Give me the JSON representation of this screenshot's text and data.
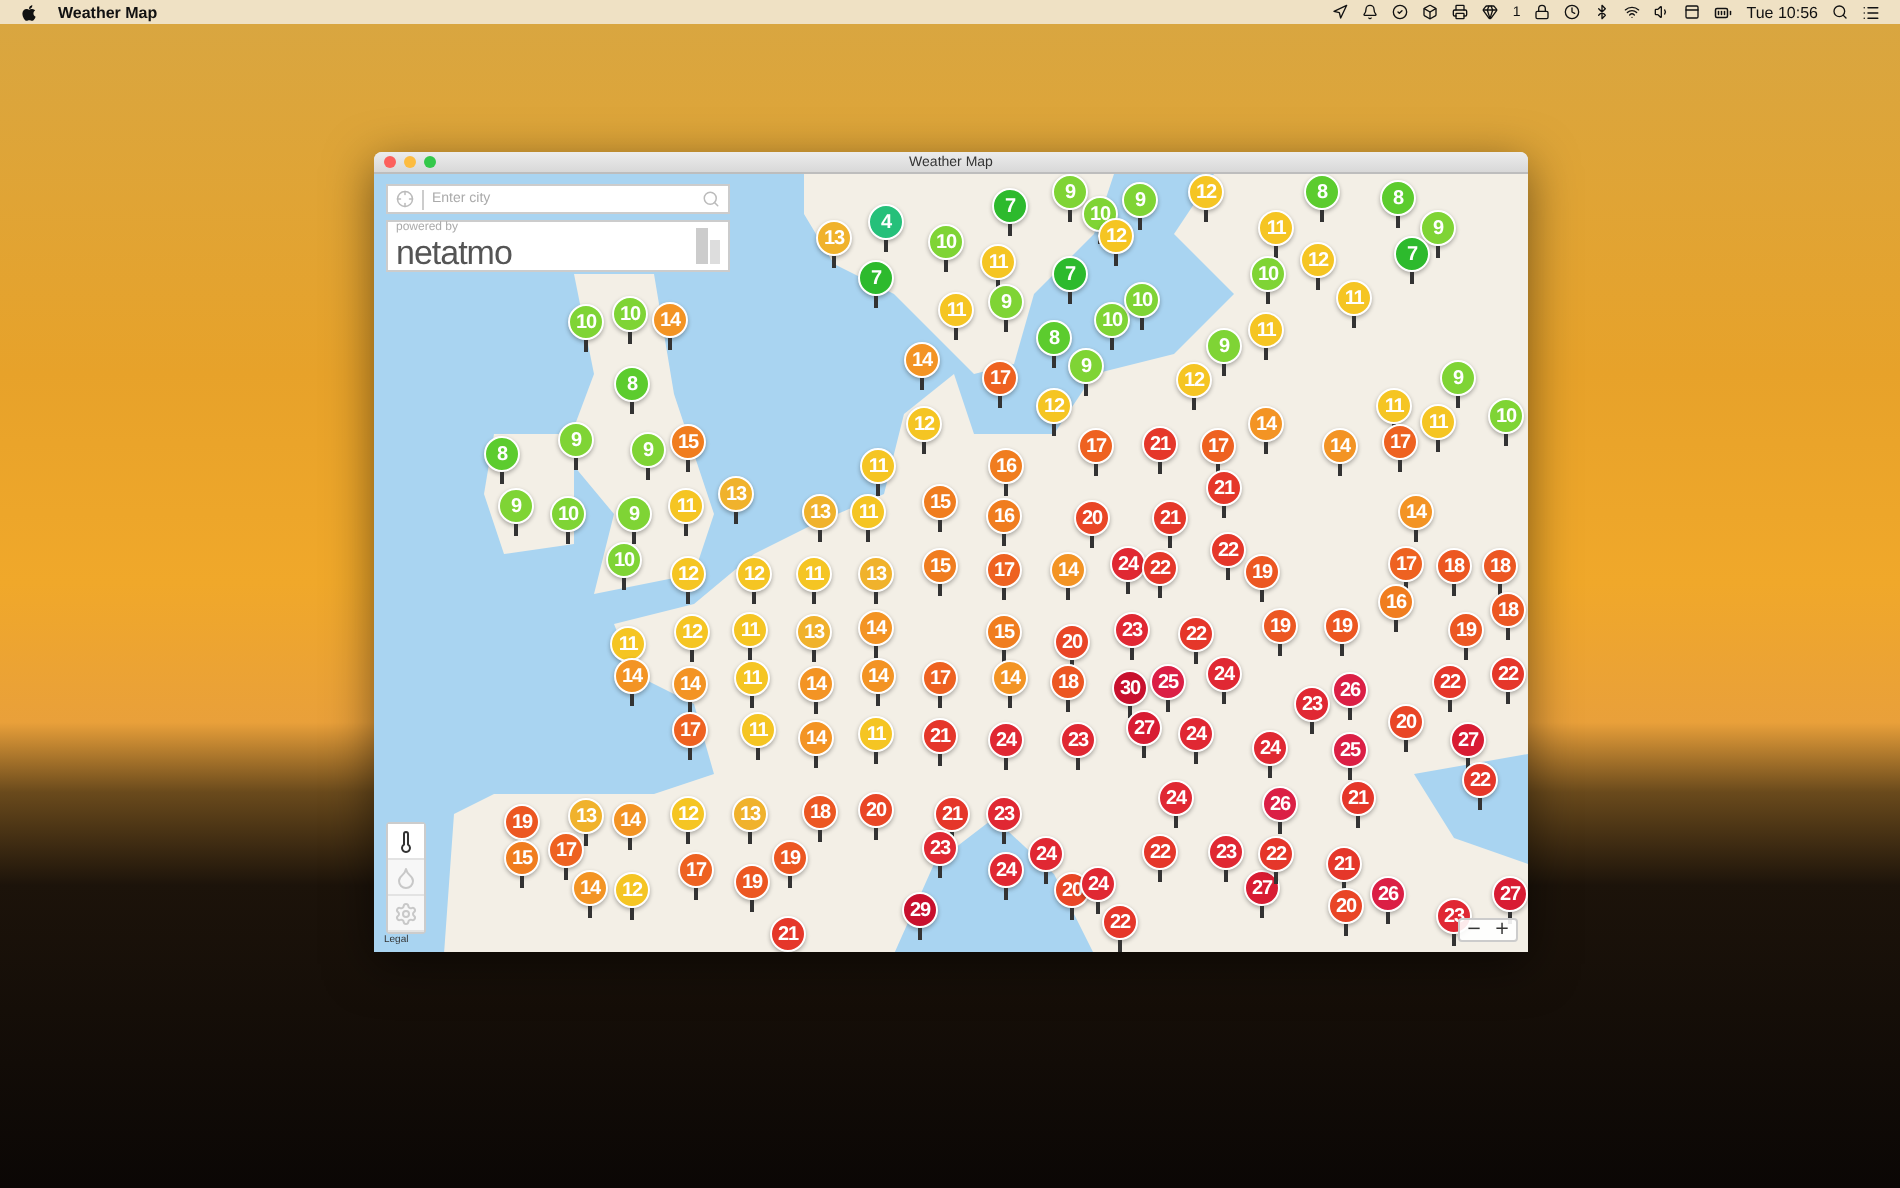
{
  "menu_bar": {
    "app_name": "Weather Map",
    "status_badge": "1",
    "clock": "Tue 10:56"
  },
  "window": {
    "title": "Weather Map"
  },
  "search": {
    "placeholder": "Enter city"
  },
  "sponsor": {
    "caption": "powered by",
    "logo": "netatmo"
  },
  "tools": [
    {
      "kind": "temperature",
      "selected": true
    },
    {
      "kind": "humidity",
      "selected": false
    },
    {
      "kind": "settings",
      "selected": false
    }
  ],
  "legal": "Legal",
  "zoom": {
    "out": "−",
    "in": "+"
  },
  "pins": [
    {
      "temp": "4",
      "color": "#25c07a"
    },
    {
      "temp": "7",
      "color": "#2dba2d"
    },
    {
      "temp": "9",
      "color": "#7fd435"
    },
    {
      "temp": "12",
      "color": "#f5c523"
    },
    {
      "temp": "8",
      "color": "#5ccc2e"
    },
    {
      "temp": "13",
      "color": "#f0b22c"
    },
    {
      "temp": "10",
      "color": "#7fd435"
    },
    {
      "temp": "7",
      "color": "#2dba2d"
    },
    {
      "temp": "11",
      "color": "#f5c523"
    },
    {
      "temp": "7",
      "color": "#2dba2d"
    },
    {
      "temp": "10",
      "color": "#7fd435"
    },
    {
      "temp": "9",
      "color": "#7fd435"
    },
    {
      "temp": "12",
      "color": "#f5c523"
    },
    {
      "temp": "8",
      "color": "#5ccc2e"
    },
    {
      "temp": "9",
      "color": "#7fd435"
    },
    {
      "temp": "7",
      "color": "#2dba2d"
    },
    {
      "temp": "11",
      "color": "#f5c523"
    },
    {
      "temp": "10",
      "color": "#7fd435"
    },
    {
      "temp": "12",
      "color": "#f5c523"
    },
    {
      "temp": "11",
      "color": "#f5c523"
    },
    {
      "temp": "10",
      "color": "#7fd435"
    },
    {
      "temp": "10",
      "color": "#7fd435"
    },
    {
      "temp": "14",
      "color": "#f39424"
    },
    {
      "temp": "11",
      "color": "#f5c523"
    },
    {
      "temp": "9",
      "color": "#7fd435"
    },
    {
      "temp": "10",
      "color": "#7fd435"
    },
    {
      "temp": "10",
      "color": "#7fd435"
    },
    {
      "temp": "8",
      "color": "#5ccc2e"
    },
    {
      "temp": "9",
      "color": "#7fd435"
    },
    {
      "temp": "9",
      "color": "#7fd435"
    },
    {
      "temp": "11",
      "color": "#f5c523"
    },
    {
      "temp": "12",
      "color": "#f5c523"
    },
    {
      "temp": "12",
      "color": "#f5c523"
    },
    {
      "temp": "11",
      "color": "#f5c523"
    },
    {
      "temp": "11",
      "color": "#f5c523"
    },
    {
      "temp": "9",
      "color": "#7fd435"
    },
    {
      "temp": "10",
      "color": "#7fd435"
    },
    {
      "temp": "14",
      "color": "#f39424"
    },
    {
      "temp": "17",
      "color": "#ee6221"
    },
    {
      "temp": "12",
      "color": "#f5c523"
    },
    {
      "temp": "8",
      "color": "#5ccc2e"
    },
    {
      "temp": "8",
      "color": "#5ccc2e"
    },
    {
      "temp": "9",
      "color": "#7fd435"
    },
    {
      "temp": "9",
      "color": "#7fd435"
    },
    {
      "temp": "15",
      "color": "#f07d1f"
    },
    {
      "temp": "9",
      "color": "#7fd435"
    },
    {
      "temp": "10",
      "color": "#7fd435"
    },
    {
      "temp": "9",
      "color": "#7fd435"
    },
    {
      "temp": "11",
      "color": "#f5c523"
    },
    {
      "temp": "13",
      "color": "#f0b22c"
    },
    {
      "temp": "13",
      "color": "#f0b22c"
    },
    {
      "temp": "11",
      "color": "#f5c523"
    },
    {
      "temp": "11",
      "color": "#f5c523"
    },
    {
      "temp": "15",
      "color": "#f07d1f"
    },
    {
      "temp": "16",
      "color": "#f07d1f"
    },
    {
      "temp": "16",
      "color": "#f07d1f"
    },
    {
      "temp": "17",
      "color": "#ee6221"
    },
    {
      "temp": "21",
      "color": "#e5372a"
    },
    {
      "temp": "17",
      "color": "#ee6221"
    },
    {
      "temp": "14",
      "color": "#f39424"
    },
    {
      "temp": "14",
      "color": "#f39424"
    },
    {
      "temp": "17",
      "color": "#ee6221"
    },
    {
      "temp": "21",
      "color": "#e5372a"
    },
    {
      "temp": "20",
      "color": "#e94626"
    },
    {
      "temp": "21",
      "color": "#e5372a"
    },
    {
      "temp": "14",
      "color": "#f39424"
    },
    {
      "temp": "10",
      "color": "#7fd435"
    },
    {
      "temp": "12",
      "color": "#f5c523"
    },
    {
      "temp": "12",
      "color": "#f5c523"
    },
    {
      "temp": "11",
      "color": "#f5c523"
    },
    {
      "temp": "13",
      "color": "#f0b22c"
    },
    {
      "temp": "15",
      "color": "#f07d1f"
    },
    {
      "temp": "17",
      "color": "#ee6221"
    },
    {
      "temp": "14",
      "color": "#f39424"
    },
    {
      "temp": "24",
      "color": "#e02833"
    },
    {
      "temp": "22",
      "color": "#e5372a"
    },
    {
      "temp": "22",
      "color": "#e5372a"
    },
    {
      "temp": "19",
      "color": "#ec5722"
    },
    {
      "temp": "17",
      "color": "#ee6221"
    },
    {
      "temp": "16",
      "color": "#f07d1f"
    },
    {
      "temp": "18",
      "color": "#ec5722"
    },
    {
      "temp": "18",
      "color": "#ec5722"
    },
    {
      "temp": "18",
      "color": "#ec5722"
    },
    {
      "temp": "11",
      "color": "#f5c523"
    },
    {
      "temp": "12",
      "color": "#f5c523"
    },
    {
      "temp": "11",
      "color": "#f5c523"
    },
    {
      "temp": "13",
      "color": "#f0b22c"
    },
    {
      "temp": "14",
      "color": "#f39424"
    },
    {
      "temp": "15",
      "color": "#f07d1f"
    },
    {
      "temp": "20",
      "color": "#e94626"
    },
    {
      "temp": "23",
      "color": "#e02833"
    },
    {
      "temp": "22",
      "color": "#e5372a"
    },
    {
      "temp": "19",
      "color": "#ec5722"
    },
    {
      "temp": "19",
      "color": "#ec5722"
    },
    {
      "temp": "19",
      "color": "#ec5722"
    },
    {
      "temp": "14",
      "color": "#f39424"
    },
    {
      "temp": "14",
      "color": "#f39424"
    },
    {
      "temp": "11",
      "color": "#f5c523"
    },
    {
      "temp": "14",
      "color": "#f39424"
    },
    {
      "temp": "14",
      "color": "#f39424"
    },
    {
      "temp": "17",
      "color": "#ee6221"
    },
    {
      "temp": "14",
      "color": "#f39424"
    },
    {
      "temp": "18",
      "color": "#ec5722"
    },
    {
      "temp": "30",
      "color": "#c8102e"
    },
    {
      "temp": "25",
      "color": "#db1f45"
    },
    {
      "temp": "24",
      "color": "#e02833"
    },
    {
      "temp": "23",
      "color": "#e02833"
    },
    {
      "temp": "26",
      "color": "#db1f45"
    },
    {
      "temp": "22",
      "color": "#e5372a"
    },
    {
      "temp": "22",
      "color": "#e5372a"
    },
    {
      "temp": "17",
      "color": "#ee6221"
    },
    {
      "temp": "11",
      "color": "#f5c523"
    },
    {
      "temp": "14",
      "color": "#f39424"
    },
    {
      "temp": "11",
      "color": "#f5c523"
    },
    {
      "temp": "21",
      "color": "#e5372a"
    },
    {
      "temp": "24",
      "color": "#e02833"
    },
    {
      "temp": "23",
      "color": "#e02833"
    },
    {
      "temp": "27",
      "color": "#d81c33"
    },
    {
      "temp": "24",
      "color": "#e02833"
    },
    {
      "temp": "24",
      "color": "#e02833"
    },
    {
      "temp": "25",
      "color": "#db1f45"
    },
    {
      "temp": "20",
      "color": "#e94626"
    },
    {
      "temp": "27",
      "color": "#d81c33"
    },
    {
      "temp": "22",
      "color": "#e5372a"
    },
    {
      "temp": "19",
      "color": "#ec5722"
    },
    {
      "temp": "13",
      "color": "#f0b22c"
    },
    {
      "temp": "14",
      "color": "#f39424"
    },
    {
      "temp": "12",
      "color": "#f5c523"
    },
    {
      "temp": "13",
      "color": "#f0b22c"
    },
    {
      "temp": "18",
      "color": "#ec5722"
    },
    {
      "temp": "20",
      "color": "#e94626"
    },
    {
      "temp": "21",
      "color": "#e5372a"
    },
    {
      "temp": "23",
      "color": "#e02833"
    },
    {
      "temp": "24",
      "color": "#e02833"
    },
    {
      "temp": "26",
      "color": "#db1f45"
    },
    {
      "temp": "21",
      "color": "#e5372a"
    },
    {
      "temp": "15",
      "color": "#f07d1f"
    },
    {
      "temp": "17",
      "color": "#ee6221"
    },
    {
      "temp": "14",
      "color": "#f39424"
    },
    {
      "temp": "12",
      "color": "#f5c523"
    },
    {
      "temp": "17",
      "color": "#ee6221"
    },
    {
      "temp": "19",
      "color": "#ec5722"
    },
    {
      "temp": "19",
      "color": "#ec5722"
    },
    {
      "temp": "21",
      "color": "#e5372a"
    },
    {
      "temp": "29",
      "color": "#c8102e"
    },
    {
      "temp": "23",
      "color": "#e02833"
    },
    {
      "temp": "24",
      "color": "#e02833"
    },
    {
      "temp": "24",
      "color": "#e02833"
    },
    {
      "temp": "20",
      "color": "#e94626"
    },
    {
      "temp": "24",
      "color": "#e02833"
    },
    {
      "temp": "22",
      "color": "#e5372a"
    },
    {
      "temp": "22",
      "color": "#e5372a"
    },
    {
      "temp": "23",
      "color": "#e02833"
    },
    {
      "temp": "27",
      "color": "#d81c33"
    },
    {
      "temp": "22",
      "color": "#e5372a"
    },
    {
      "temp": "21",
      "color": "#e5372a"
    },
    {
      "temp": "20",
      "color": "#e94626"
    },
    {
      "temp": "26",
      "color": "#db1f45"
    },
    {
      "temp": "23",
      "color": "#e02833"
    },
    {
      "temp": "27",
      "color": "#d81c33"
    }
  ]
}
